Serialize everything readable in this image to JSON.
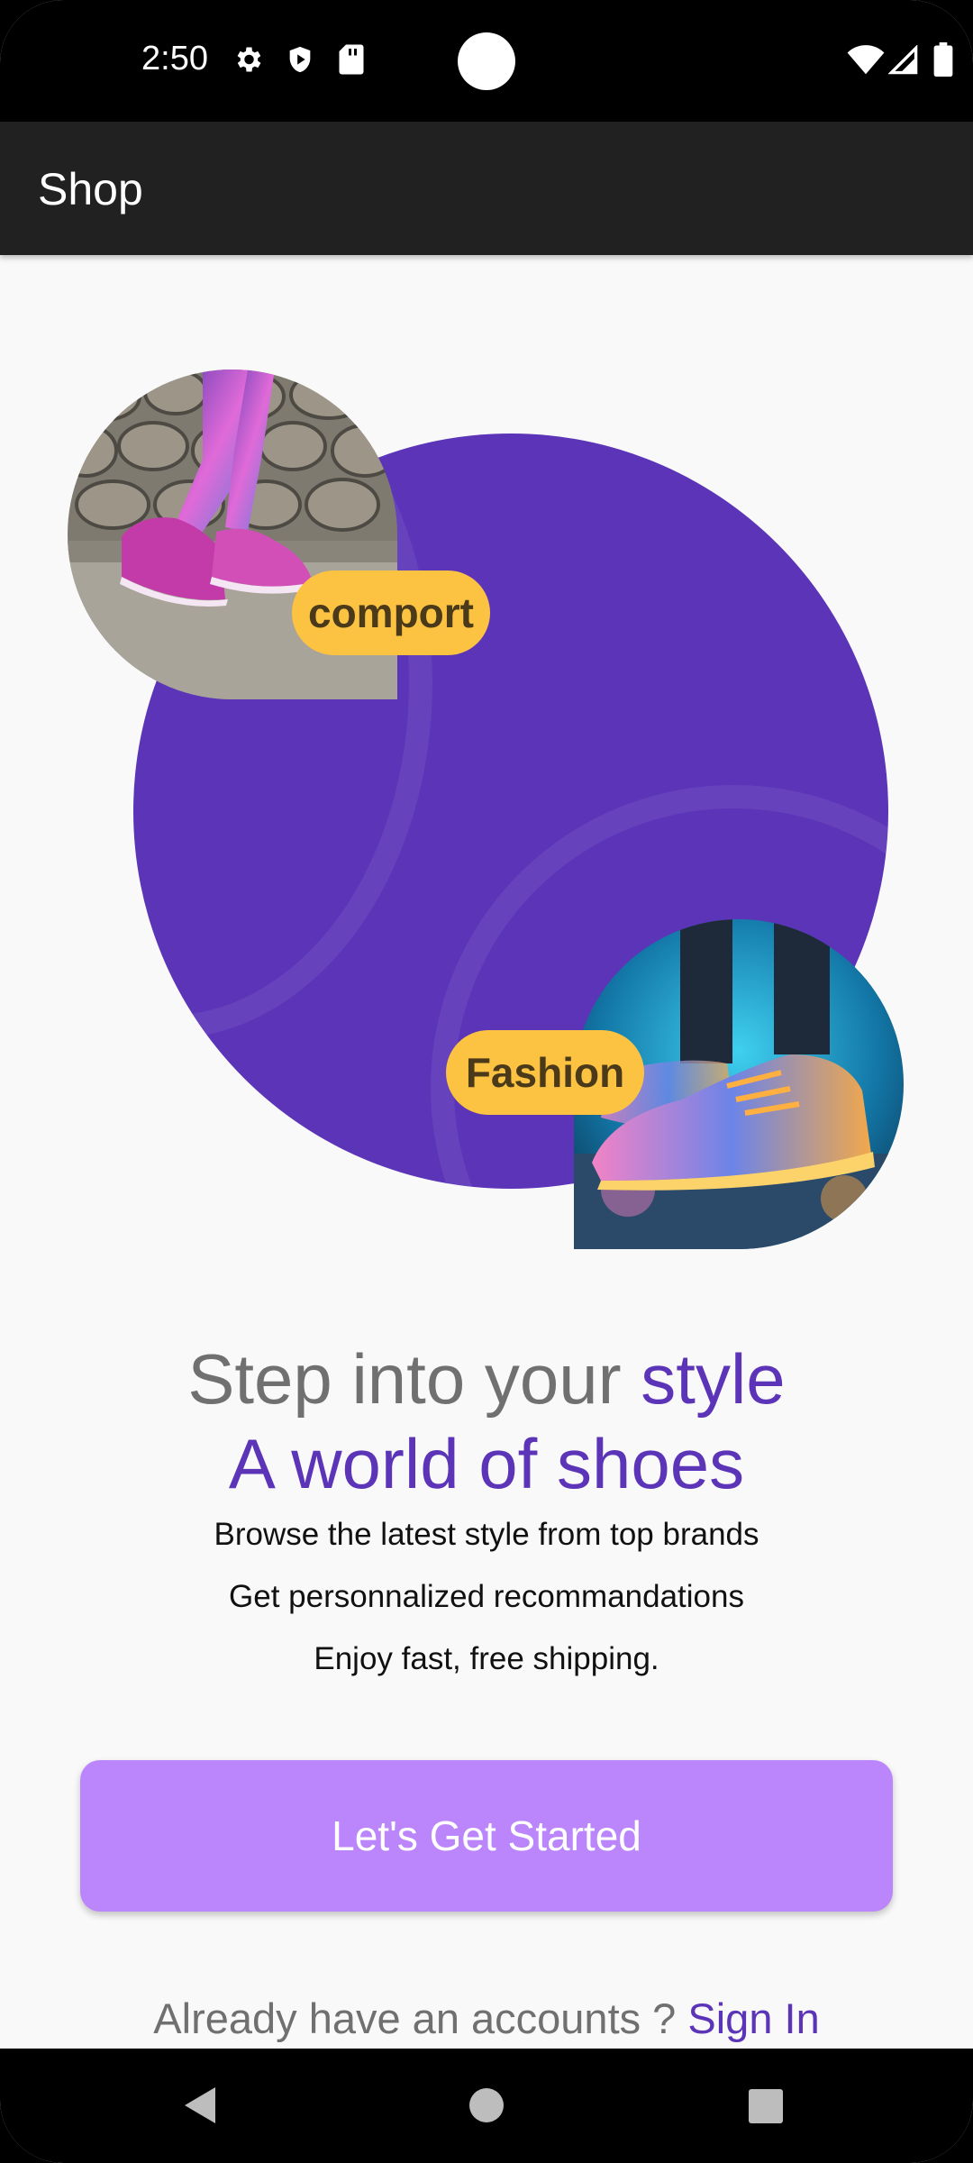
{
  "status_bar": {
    "time": "2:50",
    "icons": [
      "settings-icon",
      "shield-icon",
      "sd-card-icon",
      "wifi-icon",
      "signal-icon",
      "battery-icon"
    ]
  },
  "app_bar": {
    "title": "Shop"
  },
  "hero": {
    "tag_top": "comport",
    "tag_bottom": "Fashion",
    "colors": {
      "circle": "#5b34b8",
      "tag": "#fbc341"
    }
  },
  "headline": {
    "line1_grey": "Step into your ",
    "line1_purple": "style",
    "line2": "A world of shoes"
  },
  "features": [
    "Browse the latest style from top brands",
    "Get personnalized recommandations",
    "Enjoy fast, free shipping."
  ],
  "cta": {
    "label": "Let's Get Started",
    "color": "#bb86fc"
  },
  "signin": {
    "prompt": "Already have an accounts ? ",
    "link": "Sign In"
  },
  "nav_bar": {
    "icons": [
      "back-icon",
      "home-icon",
      "recents-icon"
    ]
  }
}
